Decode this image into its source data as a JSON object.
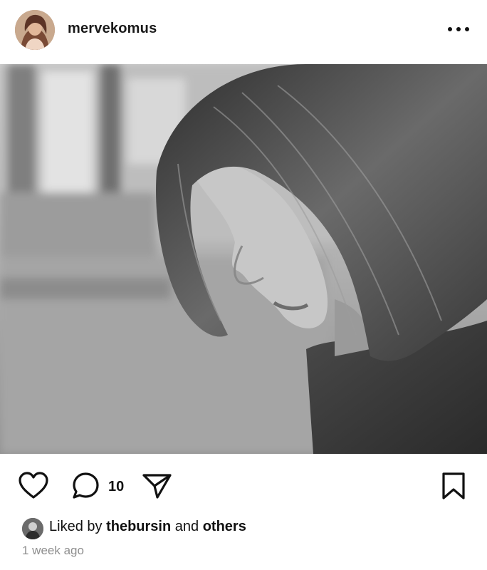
{
  "post": {
    "username": "mervekomus",
    "more_icon": "more-horizontal-icon",
    "photo_description": "",
    "comment_count": "10",
    "liked_by_prefix": "Liked by",
    "liked_by_user": "thebursin",
    "liked_by_and": "and",
    "liked_by_others": "others",
    "time_ago": "1 week ago"
  },
  "icons": {
    "like": "heart-outline-icon",
    "comment": "comment-bubble-icon",
    "share": "send-paper-plane-icon",
    "save": "bookmark-outline-icon"
  },
  "colors": {
    "text": "#111111",
    "muted": "#8e8e8e",
    "background": "#ffffff"
  }
}
